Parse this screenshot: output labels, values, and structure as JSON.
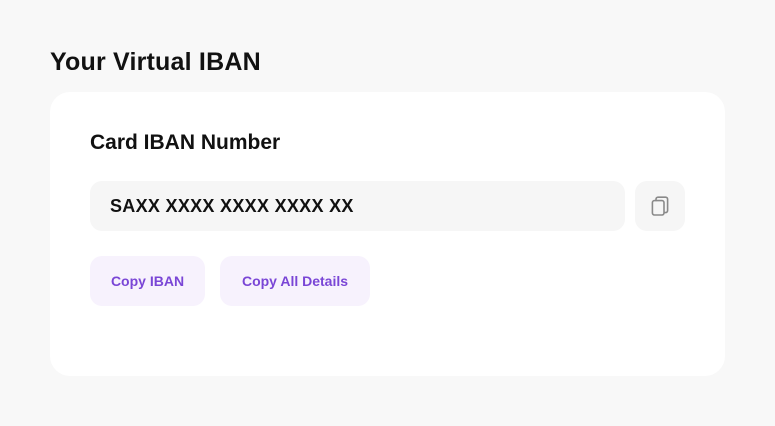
{
  "page": {
    "title": "Your Virtual IBAN"
  },
  "card": {
    "title": "Card IBAN Number",
    "iban_value": "SAXX XXXX XXXX XXXX XX",
    "copy_icon": "copy-icon",
    "buttons": {
      "copy_iban_label": "Copy IBAN",
      "copy_all_label": "Copy All Details"
    }
  },
  "colors": {
    "page_background": "#f8f8f8",
    "card_background": "#ffffff",
    "field_background": "#f6f6f6",
    "button_background": "#f7f2fd",
    "accent": "#7a46d6",
    "text_primary": "#111111"
  }
}
